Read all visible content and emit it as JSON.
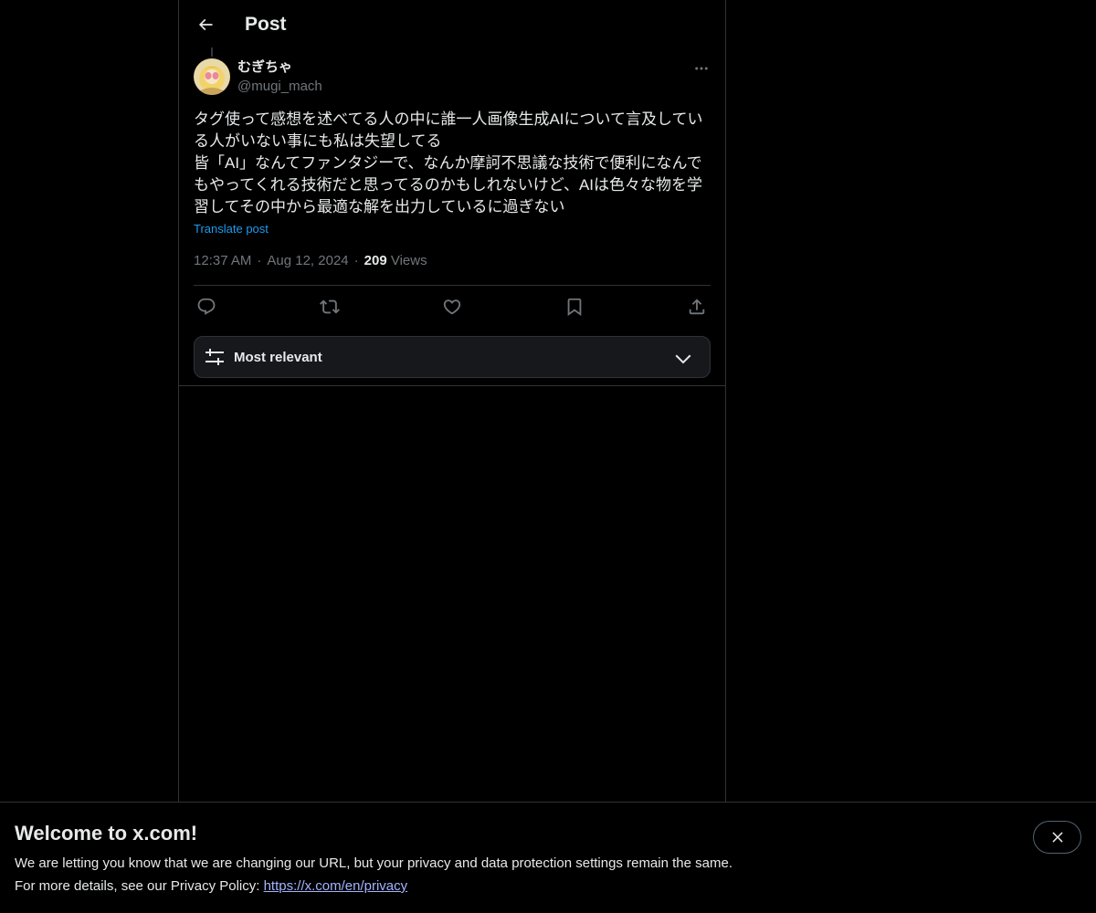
{
  "header": {
    "title": "Post",
    "back_icon": "arrow-left-icon"
  },
  "author": {
    "display_name": "むぎちゃ",
    "handle": "@mugi_mach",
    "avatar_icon": "avatar-image"
  },
  "post": {
    "lines": [
      "タグ使って感想を述べてる人の中に誰一人画像生成AIについて言及してい",
      "る人がいない事にも私は失望してる",
      "皆「AI」なんてファンタジーで、なんか摩訶不思議な技術で便利になんで",
      "もやってくれる技術だと思ってるのかもしれないけど、AIは色々な物を学",
      "習してその中から最適な解を出力しているに過ぎない"
    ],
    "translate_label": "Translate post",
    "time": "12:37 AM",
    "date": "Aug 12, 2024",
    "separator": "·",
    "views_count": "209",
    "views_label": "Views"
  },
  "actions": {
    "reply_icon": "reply-icon",
    "repost_icon": "repost-icon",
    "like_icon": "heart-icon",
    "bookmark_icon": "bookmark-icon",
    "share_icon": "share-icon"
  },
  "sort": {
    "label": "Most relevant",
    "icon": "sliders-icon",
    "chevron": "chevron-down-icon"
  },
  "banner": {
    "title": "Welcome to x.com!",
    "line1": "We are letting you know that we are changing our URL, but your privacy and data protection settings remain the same.",
    "line2_prefix": "For more details, see our Privacy Policy: ",
    "link_text": "https://x.com/en/privacy",
    "close_icon": "close-icon"
  },
  "colors": {
    "background": "#000000",
    "text_primary": "#e7e9ea",
    "text_secondary": "#71767b",
    "accent_blue": "#1d9bf0",
    "border": "#2f3336",
    "link": "#a3b4ff"
  }
}
